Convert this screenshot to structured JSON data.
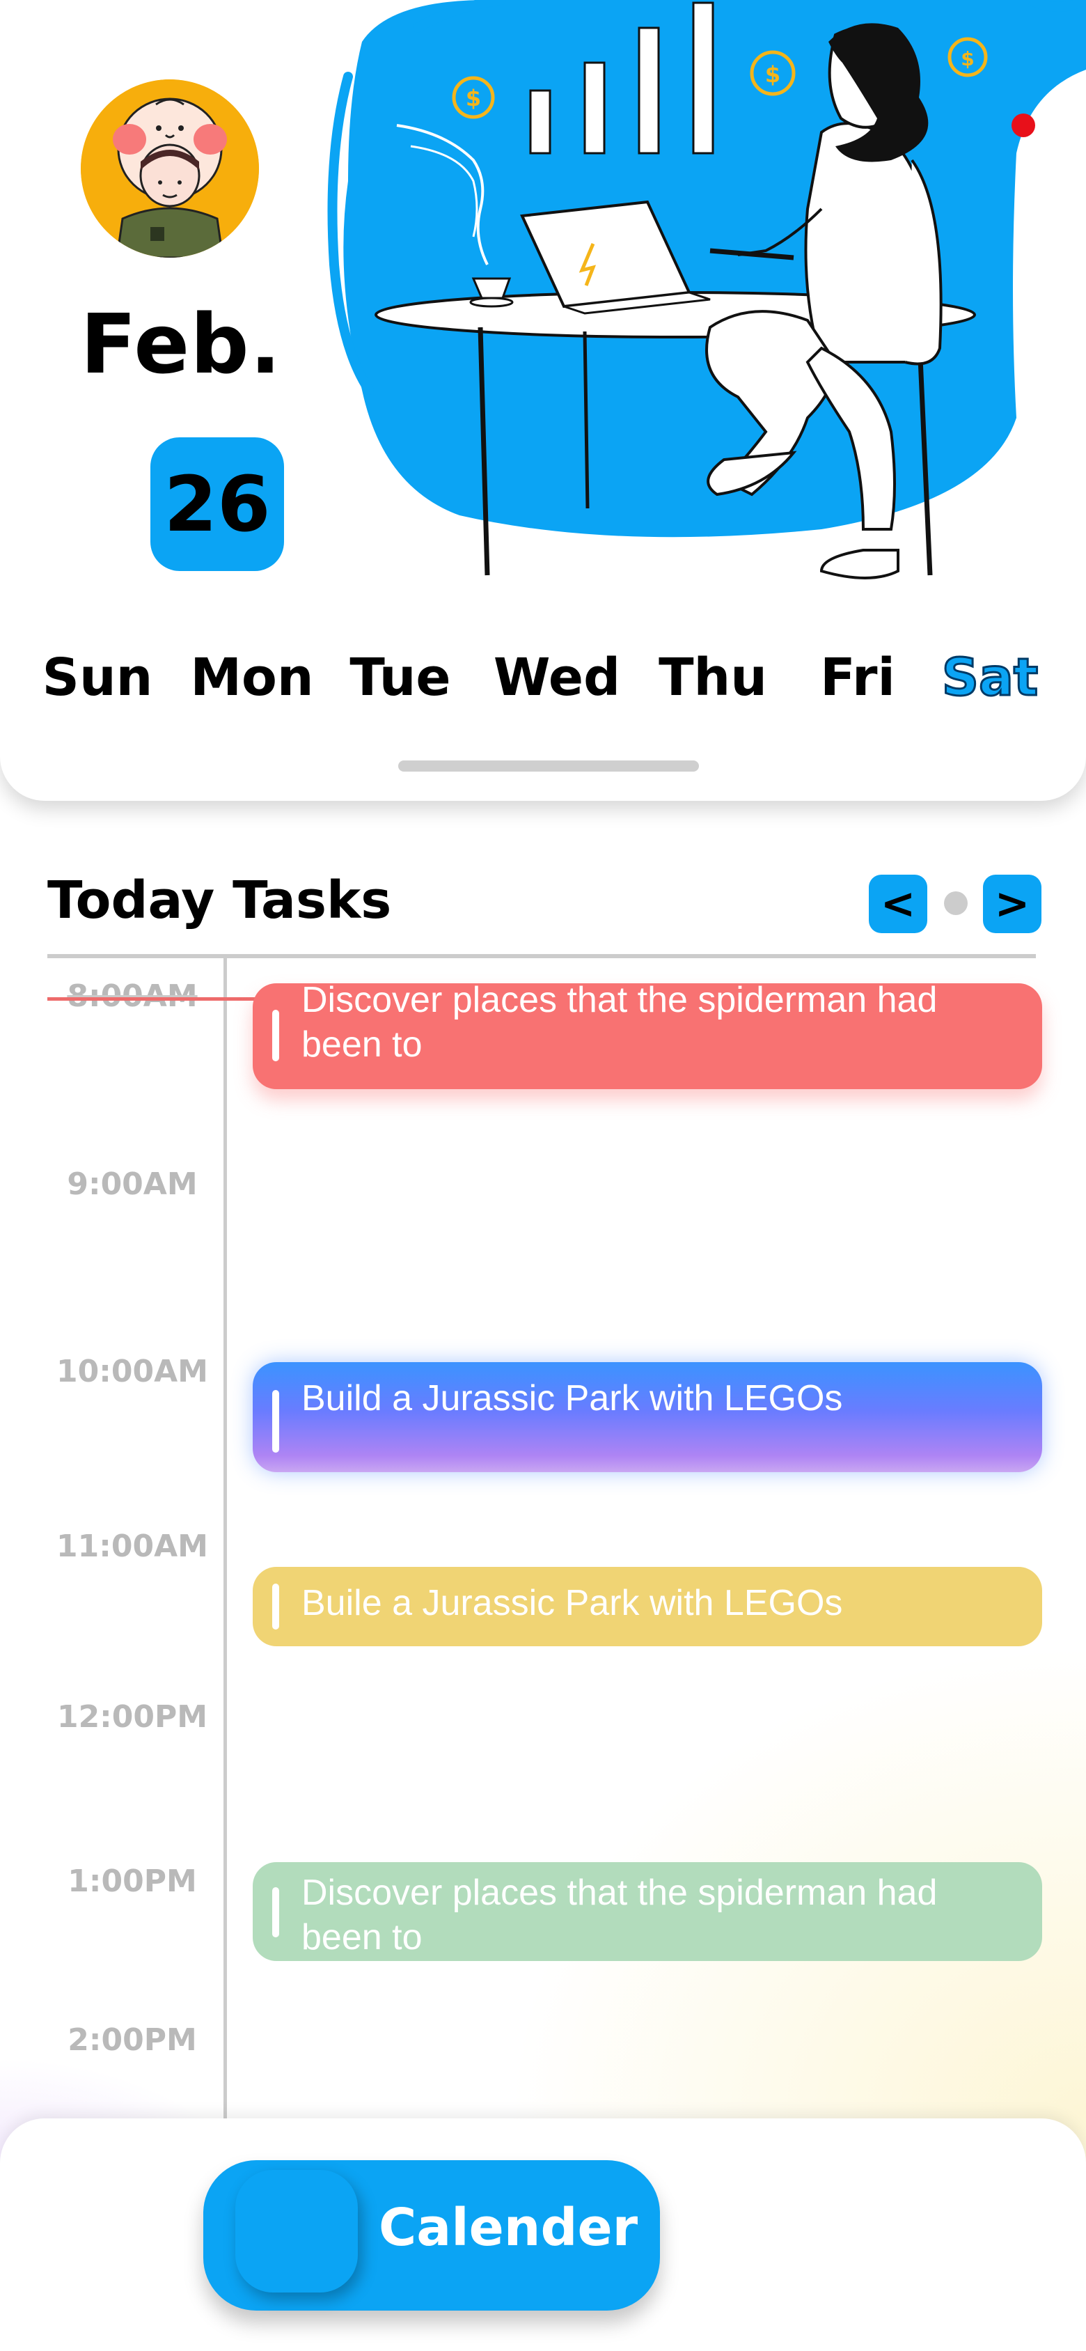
{
  "header": {
    "month": "Feb.",
    "day": "26",
    "weekdays": [
      "Sun",
      "Mon",
      "Tue",
      "Wed",
      "Thu",
      "Fri",
      "Sat"
    ],
    "selected_weekday": "Sat"
  },
  "tasks_section": {
    "title": "Today Tasks",
    "prev_label": "<",
    "next_label": ">",
    "times": [
      "8:00AM",
      "9:00AM",
      "10:00AM",
      "11:00AM",
      "12:00PM",
      "1:00PM",
      "2:00PM"
    ],
    "tasks": [
      {
        "text": "Discover places that the spiderman had been to",
        "color": "#f87272"
      },
      {
        "text": "Build a Jurassic Park with LEGOs",
        "color": "#6a7cff"
      },
      {
        "text": "Buile a Jurassic Park with LEGOs",
        "color": "#f0d474"
      },
      {
        "text": "Discover places that the spiderman had been to",
        "color": "#b2dcbc"
      }
    ]
  },
  "bottom_nav": {
    "calendar_label": "Calender"
  },
  "colors": {
    "accent": "#0ba4f4",
    "now_indicator": "#ee6b6b"
  }
}
